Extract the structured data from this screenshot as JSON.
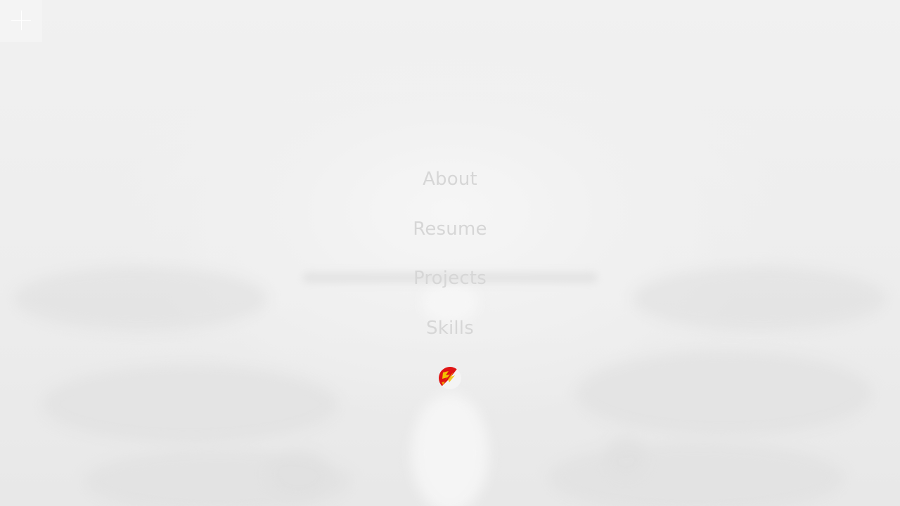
{
  "menu": {
    "toggle_icon": "plus-icon",
    "items": [
      {
        "label": "About"
      },
      {
        "label": "Resume"
      },
      {
        "label": "Projects"
      },
      {
        "label": "Skills"
      }
    ]
  },
  "logo": {
    "icon": "red-yellow-emblem-icon"
  },
  "colors": {
    "background": "#ececec",
    "nav_text": "#d6d6d6",
    "logo_red": "#e01515",
    "logo_yellow": "#f2c200"
  }
}
